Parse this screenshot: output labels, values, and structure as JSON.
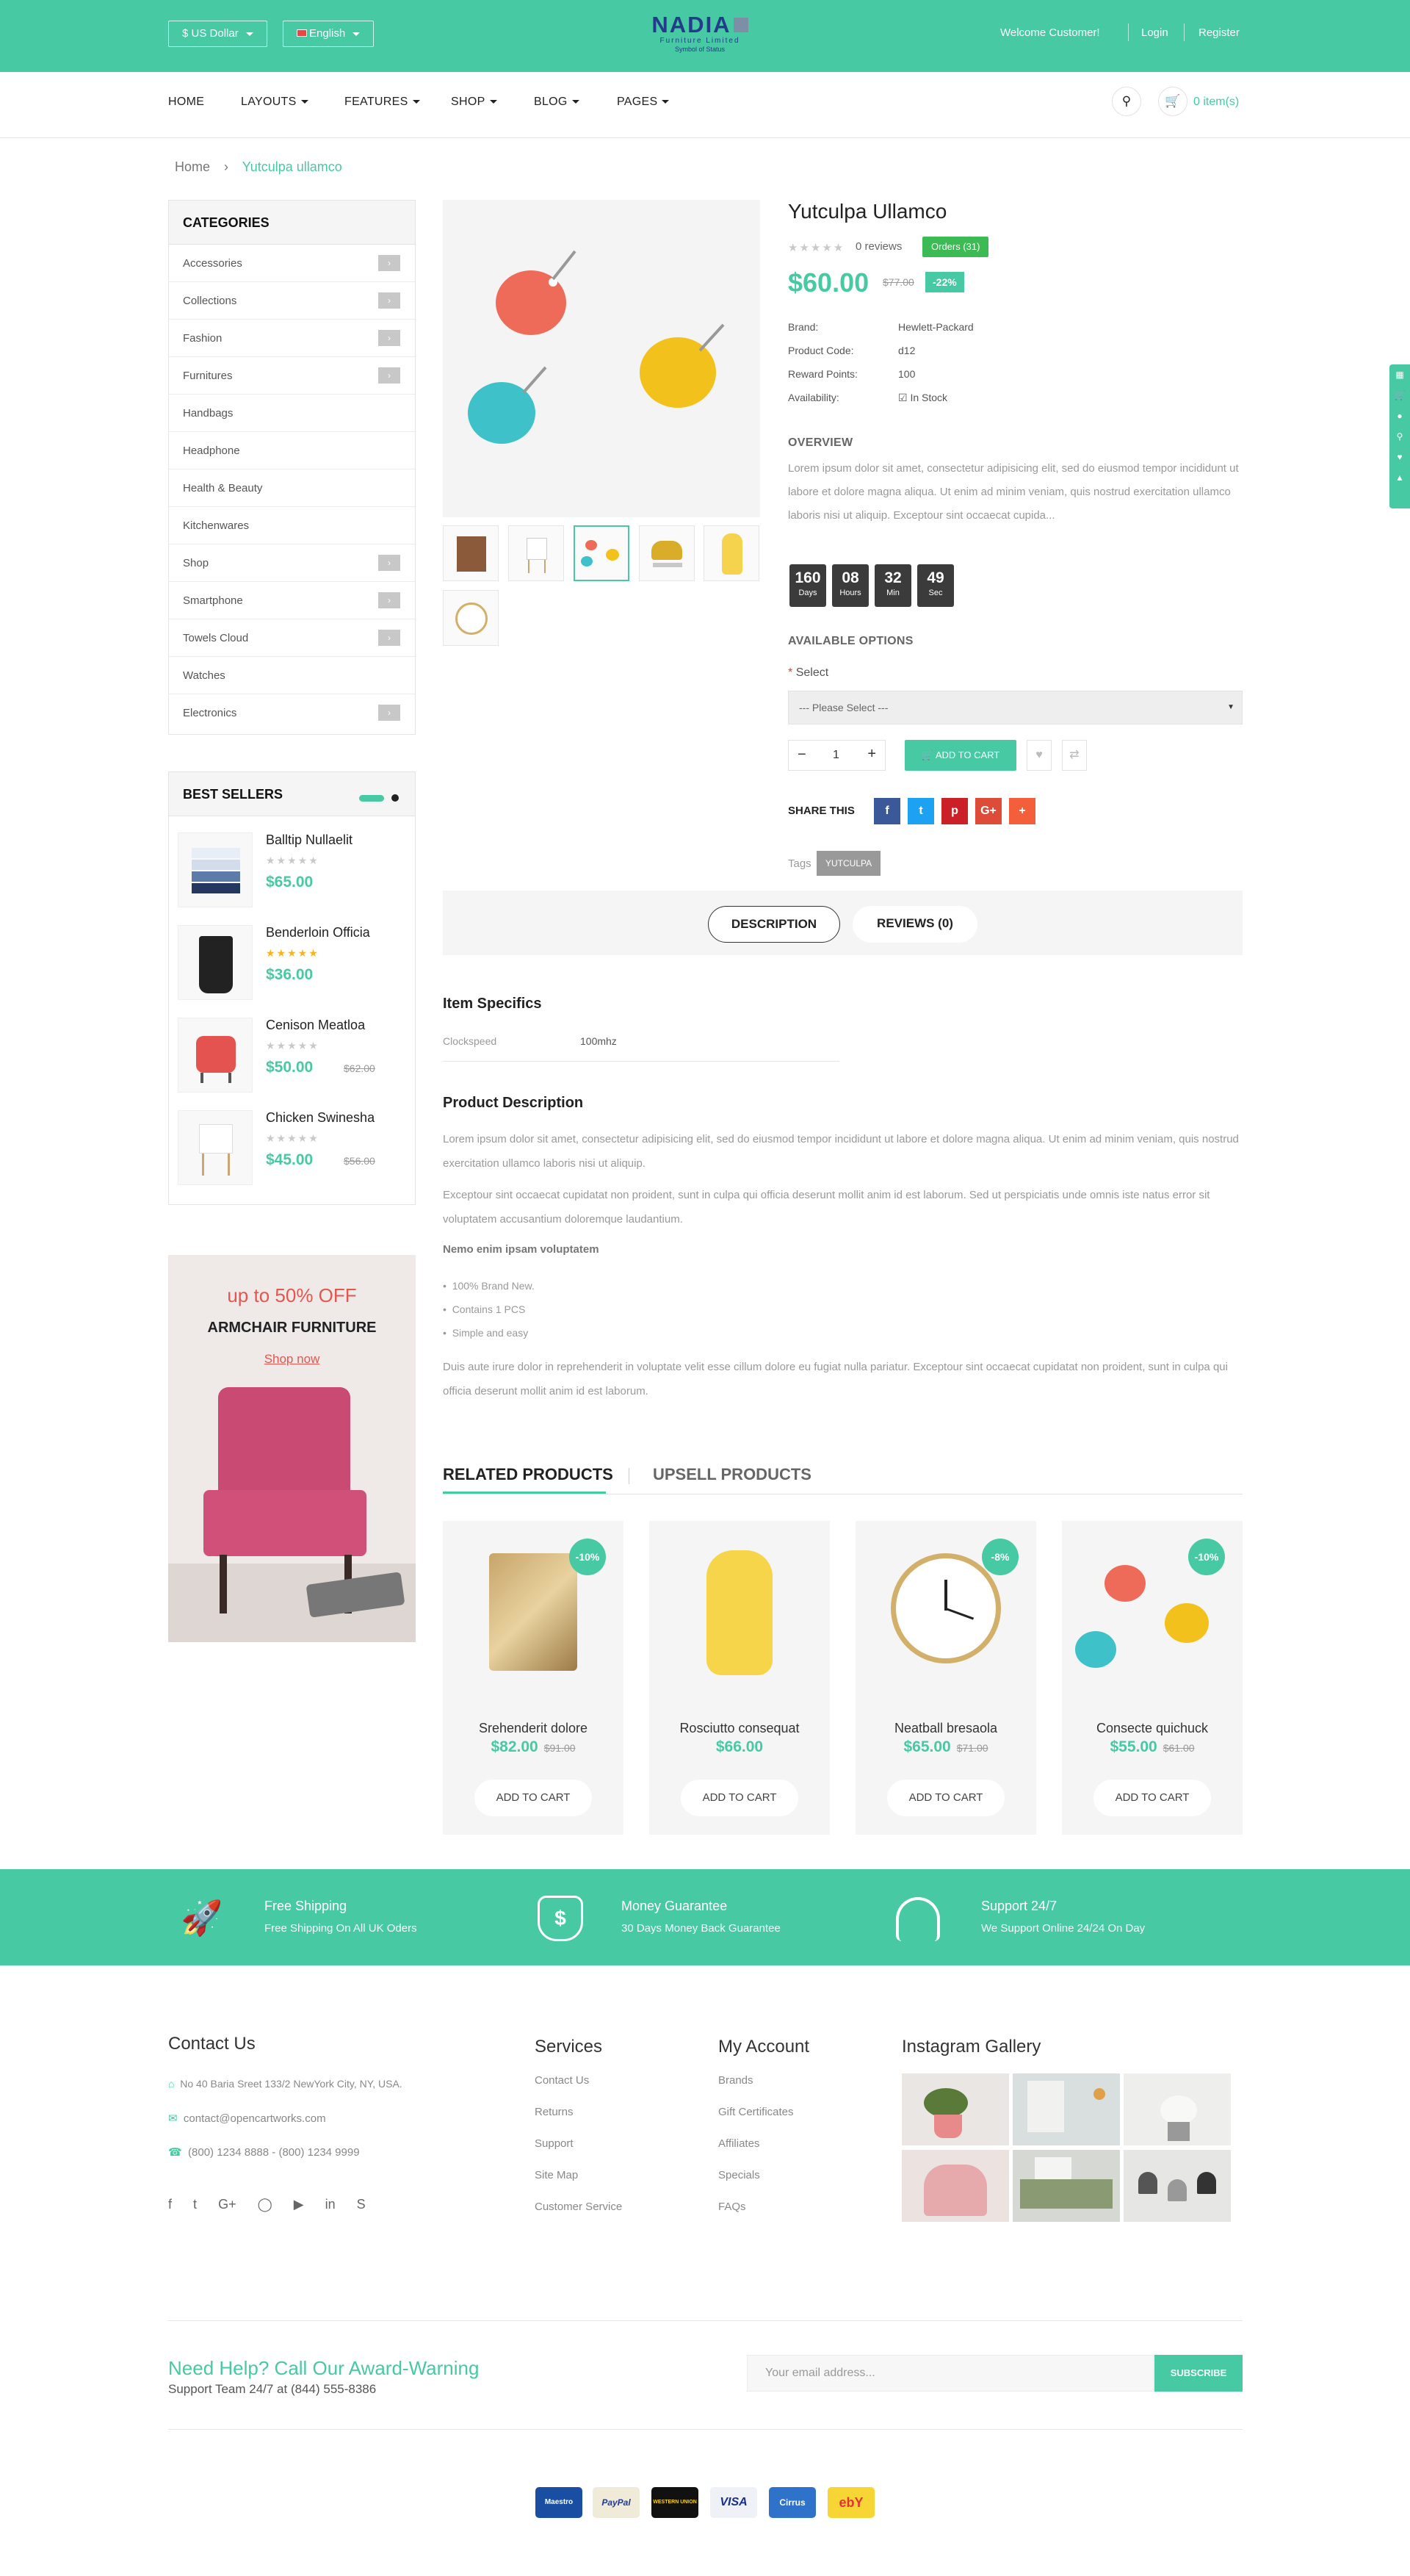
{
  "topbar": {
    "currency": "$ US Dollar",
    "language": "English",
    "logo": {
      "name": "NADIA",
      "line1": "Furniture Limited",
      "line2": "Symbol of Status"
    },
    "welcome": "Welcome Customer!",
    "login": "Login",
    "register": "Register",
    "bg_color": "#47c9a3"
  },
  "nav": {
    "items": [
      "HOME",
      "LAYOUTS",
      "FEATURES",
      "SHOP",
      "BLOG",
      "PAGES"
    ],
    "cart": "0 item(s)"
  },
  "breadcrumb": {
    "home": "Home",
    "current": "Yutculpa ullamco"
  },
  "categories": {
    "title": "CATEGORIES",
    "items": [
      "Accessories",
      "Collections",
      "Fashion",
      "Furnitures",
      "Handbags",
      "Headphone",
      "Health & Beauty",
      "Kitchenwares",
      "Shop",
      "Smartphone",
      "Towels Cloud",
      "Watches",
      "Electronics"
    ]
  },
  "best_sellers": {
    "title": "BEST SELLERS",
    "items": [
      {
        "name": "Balltip Nullaelit",
        "price": "$65.00",
        "old": "",
        "rating": 0
      },
      {
        "name": "Benderloin Officia",
        "price": "$36.00",
        "old": "",
        "rating": 5
      },
      {
        "name": "Cenison Meatloa",
        "price": "$50.00",
        "old": "$62.00",
        "rating": 0
      },
      {
        "name": "Chicken Swinesha",
        "price": "$45.00",
        "old": "$56.00",
        "rating": 0
      }
    ]
  },
  "banner": {
    "offer": "up to 50% OFF",
    "title": "ARMCHAIR FURNITURE",
    "cta": "Shop now"
  },
  "product": {
    "title": "Yutculpa Ullamco",
    "reviews": "0 reviews",
    "orders": "Orders (31)",
    "price": "$60.00",
    "old_price": "$77.00",
    "discount": "-22%",
    "brand_label": "Brand:",
    "brand": "Hewlett-Packard",
    "code_label": "Product Code:",
    "code": "d12",
    "points_label": "Reward Points:",
    "points": "100",
    "avail_label": "Availability:",
    "avail": "In Stock",
    "overview_title": "OVERVIEW",
    "overview": "Lorem ipsum dolor sit amet, consectetur adipisicing elit, sed do eiusmod tempor incididunt ut labore et dolore magna aliqua. Ut enim ad minim veniam, quis nostrud exercitation ullamco laboris nisi ut aliquip. Exceptour sint occaecat cupida...",
    "countdown": [
      {
        "n": "160",
        "l": "Days"
      },
      {
        "n": "08",
        "l": "Hours"
      },
      {
        "n": "32",
        "l": "Min"
      },
      {
        "n": "49",
        "l": "Sec"
      }
    ],
    "options_title": "AVAILABLE OPTIONS",
    "select_label": "Select",
    "select_placeholder": "--- Please Select ---",
    "qty": "1",
    "add_to_cart": "ADD TO CART",
    "share_label": "SHARE THIS",
    "tags_label": "Tags",
    "tag": "YUTCULPA"
  },
  "tabs": {
    "description": "DESCRIPTION",
    "reviews": "REVIEWS (0)"
  },
  "specifics": {
    "title": "Item Specifics",
    "key": "Clockspeed",
    "value": "100mhz"
  },
  "description": {
    "title": "Product Description",
    "p1": "Lorem ipsum dolor sit amet, consectetur adipisicing elit, sed do eiusmod tempor incididunt ut labore et dolore magna aliqua. Ut enim ad minim veniam, quis nostrud exercitation ullamco laboris nisi ut aliquip.",
    "p2": "Exceptour sint occaecat cupidatat non proident, sunt in culpa qui officia deserunt mollit anim id est laborum. Sed ut perspiciatis unde omnis iste natus error sit voluptatem accusantium doloremque laudantium.",
    "subtitle": "Nemo enim ipsam voluptatem",
    "bullets": [
      "100% Brand New.",
      "Contains 1 PCS",
      "Simple and easy"
    ],
    "p3": "Duis aute irure dolor in reprehenderit in voluptate velit esse cillum dolore eu fugiat nulla pariatur. Exceptour sint occaecat cupidatat non proident, sunt in culpa qui officia deserunt mollit anim id est laborum."
  },
  "related": {
    "tab1": "RELATED PRODUCTS",
    "tab2": "UPSELL PRODUCTS",
    "items": [
      {
        "name": "Srehenderit dolore",
        "price": "$82.00",
        "old": "$91.00",
        "badge": "-10%",
        "btn": "ADD TO CART"
      },
      {
        "name": "Rosciutto consequat",
        "price": "$66.00",
        "old": "",
        "badge": "",
        "btn": "ADD TO CART"
      },
      {
        "name": "Neatball bresaola",
        "price": "$65.00",
        "old": "$71.00",
        "badge": "-8%",
        "btn": "ADD TO CART"
      },
      {
        "name": "Consecte quichuck",
        "price": "$55.00",
        "old": "$61.00",
        "badge": "-10%",
        "btn": "ADD TO CART"
      }
    ]
  },
  "features": [
    {
      "title": "Free Shipping",
      "sub": "Free Shipping On All UK Oders"
    },
    {
      "title": "Money Guarantee",
      "sub": "30 Days Money Back Guarantee"
    },
    {
      "title": "Support 24/7",
      "sub": "We Support Online 24/24 On Day"
    }
  ],
  "footer": {
    "contact_title": "Contact Us",
    "address": "No 40 Baria Sreet 133/2 NewYork City, NY, USA.",
    "email": "contact@opencartworks.com",
    "phone": "(800) 1234 8888 - (800) 1234 9999",
    "services_title": "Services",
    "services": [
      "Contact Us",
      "Returns",
      "Support",
      "Site Map",
      "Customer Service"
    ],
    "account_title": "My Account",
    "account": [
      "Brands",
      "Gift Certificates",
      "Affiliates",
      "Specials",
      "FAQs"
    ],
    "instagram_title": "Instagram Gallery",
    "help_title": "Need Help? Call Our Award-Warning",
    "help_sub": "Support Team 24/7 at (844) 555-8386",
    "email_placeholder": "Your email address...",
    "subscribe": "SUBSCRIBE",
    "payments": [
      "Maestro",
      "PayPal",
      "WESTERN UNION",
      "VISA",
      "Cirrus",
      "ebY"
    ]
  }
}
